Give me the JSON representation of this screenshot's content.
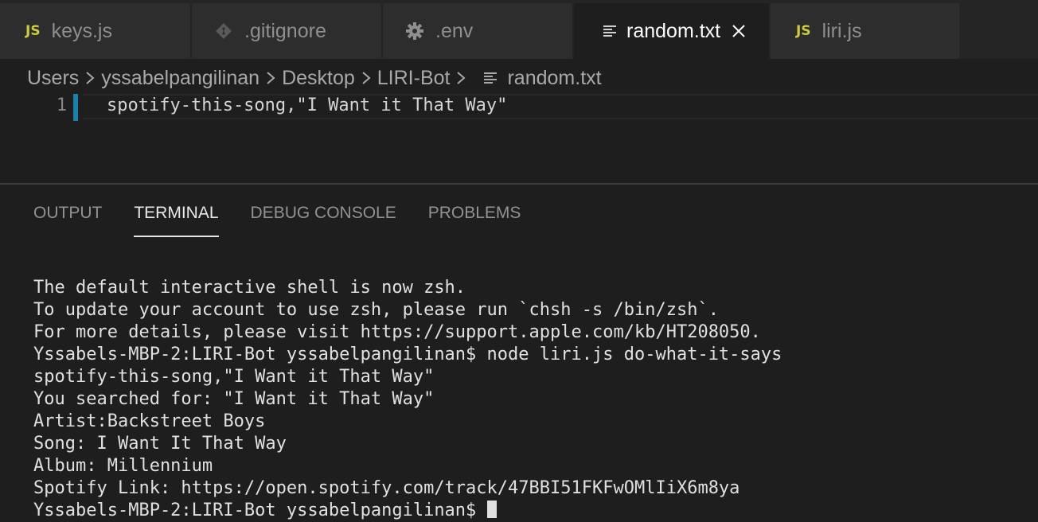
{
  "tabs": [
    {
      "label": "keys.js",
      "icon": "js-icon",
      "active": false
    },
    {
      "label": ".gitignore",
      "icon": "git-icon",
      "active": false
    },
    {
      "label": ".env",
      "icon": "gear-icon",
      "active": false
    },
    {
      "label": "random.txt",
      "icon": "text-lines-icon",
      "active": true
    },
    {
      "label": "liri.js",
      "icon": "js-icon",
      "active": false
    }
  ],
  "js_badge": "JS",
  "breadcrumb": [
    "Users",
    "yssabelpangilinan",
    "Desktop",
    "LIRI-Bot",
    "random.txt"
  ],
  "editor": {
    "line_number": "1",
    "line_text": "spotify-this-song,\"I Want it That Way\""
  },
  "panel": {
    "tabs": [
      "OUTPUT",
      "TERMINAL",
      "DEBUG CONSOLE",
      "PROBLEMS"
    ],
    "active_tab": "TERMINAL"
  },
  "terminal": {
    "lines": [
      "The default interactive shell is now zsh.",
      "To update your account to use zsh, please run `chsh -s /bin/zsh`.",
      "For more details, please visit https://support.apple.com/kb/HT208050.",
      "Yssabels-MBP-2:LIRI-Bot yssabelpangilinan$ node liri.js do-what-it-says",
      "spotify-this-song,\"I Want it That Way\"",
      "You searched for: \"I Want it That Way\"",
      "Artist:Backstreet Boys",
      "Song: I Want It That Way",
      "Album: Millennium",
      "Spotify Link: https://open.spotify.com/track/47BBI51FKFwOMlIiX6m8ya"
    ],
    "prompt": "Yssabels-MBP-2:LIRI-Bot yssabelpangilinan$ "
  },
  "colors": {
    "accent": "#1b81a8",
    "js_icon": "#cbcb41",
    "editor_bg": "#1e1e1e",
    "tabbar_bg": "#252526"
  }
}
